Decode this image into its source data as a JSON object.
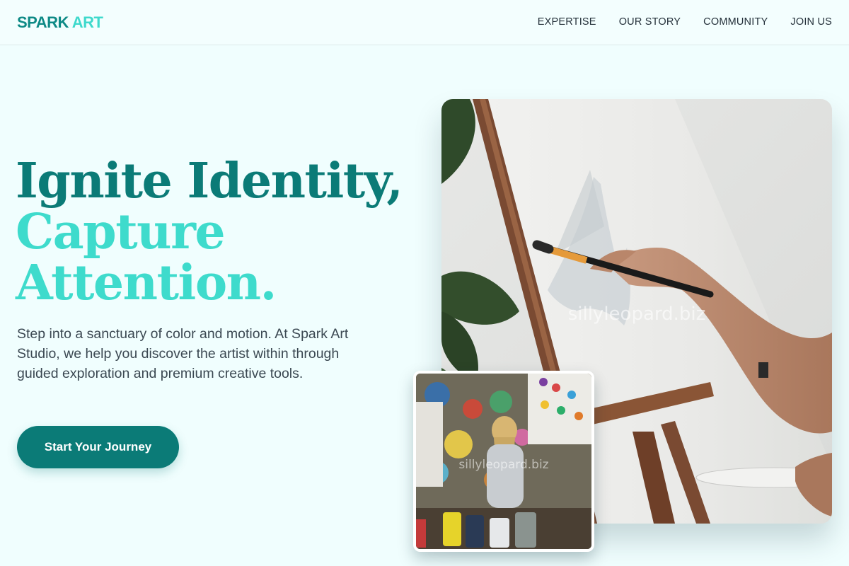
{
  "header": {
    "logo_part1": "SPARK",
    "logo_part2": "ART",
    "nav": [
      "EXPERTISE",
      "OUR STORY",
      "COMMUNITY",
      "JOIN US"
    ]
  },
  "hero": {
    "title_line1": "Ignite Identity,",
    "title_line2": "Capture",
    "title_line3": "Attention.",
    "description": "Step into a sanctuary of color and motion. At Spark Art Studio, we help you discover the artist within through guided exploration and premium creative tools.",
    "cta_label": "Start Your Journey"
  },
  "images": {
    "main_watermark": "sillyleopard.biz",
    "small_watermark": "sillyleopard.biz"
  },
  "colors": {
    "brand_dark": "#0b7b77",
    "brand_light": "#3edbcc",
    "background": "#f0fefe"
  }
}
